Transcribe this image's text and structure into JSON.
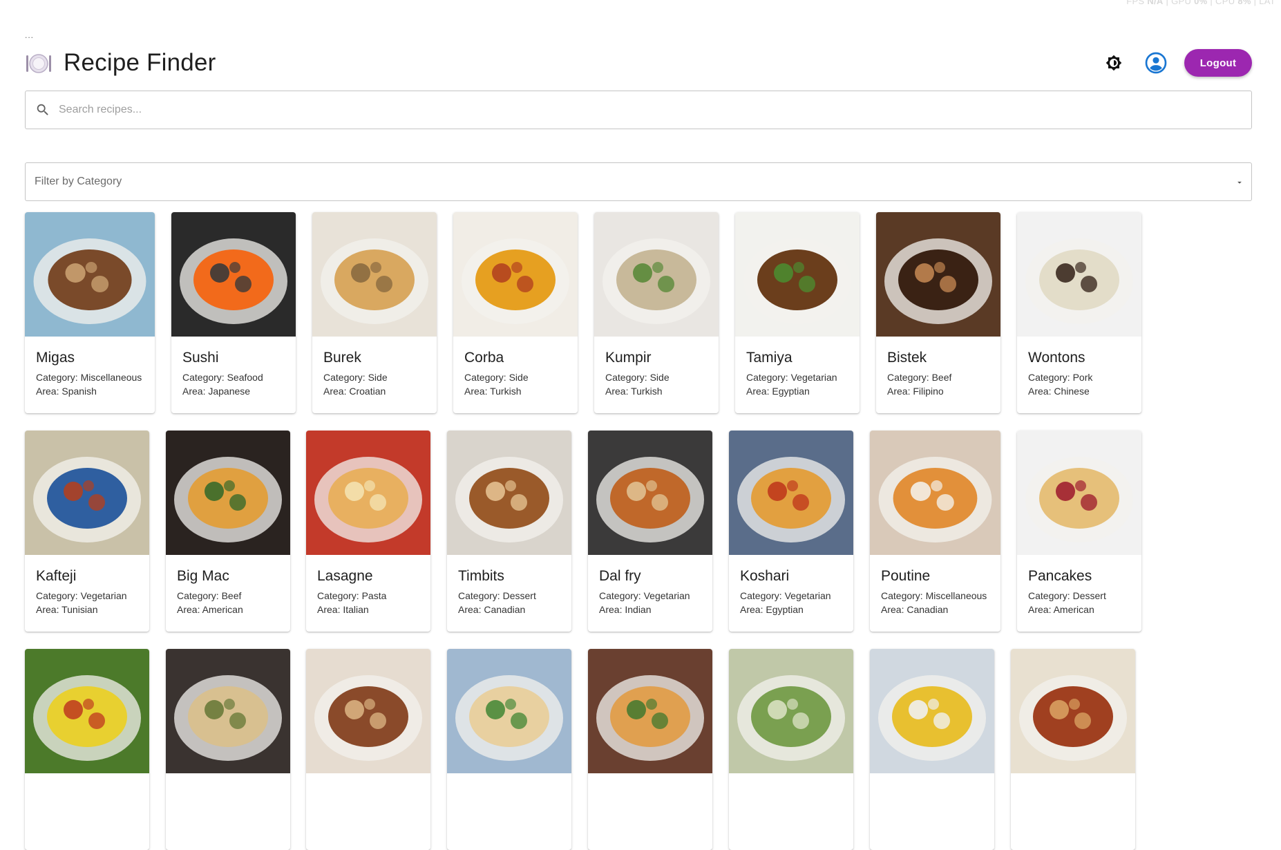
{
  "status_overlay": {
    "fps_label": "FPS",
    "fps_value": "N/A",
    "gpu_label": "GPU",
    "gpu_value": "0%",
    "cpu_label": "CPU",
    "cpu_value": "8%",
    "lat_label": "LAT"
  },
  "breadcrumb": "...",
  "app": {
    "title": "Recipe Finder",
    "logo_icon": "plate-icon"
  },
  "header_actions": {
    "theme_icon": "brightness-icon",
    "account_icon": "account-circle-icon",
    "logout_label": "Logout"
  },
  "search": {
    "placeholder": "Search recipes...",
    "value": "",
    "icon": "search-icon"
  },
  "filter": {
    "label": "Filter by Category",
    "icon": "dropdown-arrow-icon"
  },
  "labels": {
    "category_prefix": "Category: ",
    "area_prefix": "Area: "
  },
  "colors": {
    "accent": "#9c27b0",
    "account_icon": "#1976d2"
  },
  "recipes": [
    {
      "name": "Migas",
      "category": "Miscellaneous",
      "area": "Spanish"
    },
    {
      "name": "Sushi",
      "category": "Seafood",
      "area": "Japanese"
    },
    {
      "name": "Burek",
      "category": "Side",
      "area": "Croatian"
    },
    {
      "name": "Corba",
      "category": "Side",
      "area": "Turkish"
    },
    {
      "name": "Kumpir",
      "category": "Side",
      "area": "Turkish"
    },
    {
      "name": "Tamiya",
      "category": "Vegetarian",
      "area": "Egyptian"
    },
    {
      "name": "Bistek",
      "category": "Beef",
      "area": "Filipino"
    },
    {
      "name": "Wontons",
      "category": "Pork",
      "area": "Chinese"
    },
    {
      "name": "Kafteji",
      "category": "Vegetarian",
      "area": "Tunisian"
    },
    {
      "name": "Big Mac",
      "category": "Beef",
      "area": "American"
    },
    {
      "name": "Lasagne",
      "category": "Pasta",
      "area": "Italian"
    },
    {
      "name": "Timbits",
      "category": "Dessert",
      "area": "Canadian"
    },
    {
      "name": "Dal fry",
      "category": "Vegetarian",
      "area": "Indian"
    },
    {
      "name": "Koshari",
      "category": "Vegetarian",
      "area": "Egyptian"
    },
    {
      "name": "Poutine",
      "category": "Miscellaneous",
      "area": "Canadian"
    },
    {
      "name": "Pancakes",
      "category": "Dessert",
      "area": "American"
    }
  ]
}
